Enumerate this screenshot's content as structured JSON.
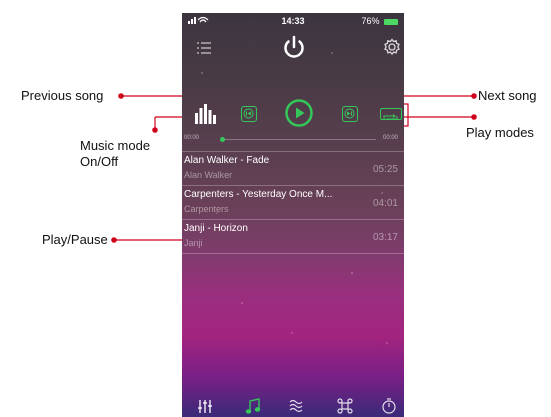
{
  "annotations": {
    "previous_song": "Previous song",
    "next_song": "Next song",
    "play_modes": "Play modes",
    "music_mode": "Music mode\nOn/Off",
    "music_mode_line1": "Music mode",
    "music_mode_line2": "On/Off",
    "play_pause": "Play/Pause"
  },
  "status_bar": {
    "time": "14:33",
    "battery": "76%"
  },
  "player": {
    "elapsed": "00:00",
    "total": "00:00"
  },
  "songs": [
    {
      "title": "Alan Walker - Fade",
      "artist": "Alan Walker",
      "duration": "05:25"
    },
    {
      "title": "Carpenters - Yesterday Once M...",
      "artist": "Carpenters",
      "duration": "04:01"
    },
    {
      "title": "Janji - Horizon",
      "artist": "Janji",
      "duration": "03:17"
    }
  ],
  "colors": {
    "accent": "#34c759",
    "callout_line": "#d0021b"
  },
  "icons": {
    "menu": "list-icon",
    "power": "power-icon",
    "settings": "gear-icon",
    "music_mode": "equalizer-icon",
    "previous": "previous-icon",
    "play": "play-icon",
    "next": "next-icon",
    "play_mode": "repeat-icon"
  }
}
